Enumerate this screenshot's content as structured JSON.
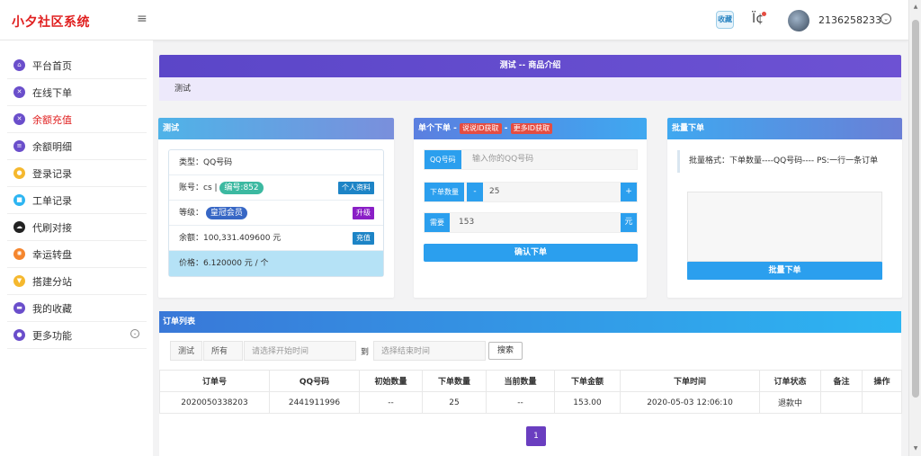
{
  "header": {
    "brand": "小夕社区系统",
    "menu_icon": "≡",
    "fav_label": "收藏",
    "username": "2136258233"
  },
  "sidebar": {
    "items": [
      {
        "label": "平台首页",
        "icon": "home-icon",
        "color": "#6a4ecb"
      },
      {
        "label": "在线下单",
        "icon": "cart-icon",
        "color": "#6a4ecb"
      },
      {
        "label": "余额充值",
        "icon": "wallet-icon",
        "color": "#6a4ecb"
      },
      {
        "label": "余额明细",
        "icon": "list-icon",
        "color": "#6a4ecb"
      },
      {
        "label": "登录记录",
        "icon": "login-icon",
        "color": "#f5b82e"
      },
      {
        "label": "工单记录",
        "icon": "ticket-icon",
        "color": "#2db5f2"
      },
      {
        "label": "代刷对接",
        "icon": "cloud-icon",
        "color": "#222222"
      },
      {
        "label": "幸运转盘",
        "icon": "wheel-icon",
        "color": "#f5862e"
      },
      {
        "label": "搭建分站",
        "icon": "build-icon",
        "color": "#f5b82e"
      },
      {
        "label": "我的收藏",
        "icon": "collect-icon",
        "color": "#6a4ecb"
      },
      {
        "label": "更多功能",
        "icon": "more-icon",
        "color": "#6a4ecb"
      }
    ],
    "active_index": 2
  },
  "intro": {
    "title": "测试 -- 商品介绍",
    "body": "测试"
  },
  "info_panel": {
    "title": "测试",
    "type_text": "类型：QQ号码",
    "account_text": "账号：cs |",
    "id_badge": "编号:852",
    "profile_btn": "个人资料",
    "level_text": "等级：",
    "level_badge": "皇冠会员",
    "upgrade_btn": "升级",
    "balance_text": "余额：100,331.409600 元",
    "recharge_btn": "充值",
    "price_text": "价格：6.120000 元 / 个"
  },
  "order_panel": {
    "title": "单个下单 -",
    "tag1": "说说ID获取",
    "sep": "-",
    "tag2": "更多ID获取",
    "qq_label": "QQ号码",
    "qq_placeholder": "输入你的QQ号码",
    "qty_label": "下单数量",
    "minus": "-",
    "qty_value": "25",
    "plus": "+",
    "need_label": "需要",
    "need_value": "153",
    "unit": "元",
    "confirm": "确认下单"
  },
  "batch_panel": {
    "title": "批量下单",
    "note": "批量格式：下单数量----QQ号码---- PS:一行一条订单",
    "button": "批量下单"
  },
  "orders": {
    "title": "订单列表",
    "filter_product": "测试",
    "filter_status": "所有",
    "start_placeholder": "请选择开始时间",
    "to": "到",
    "end_placeholder": "选择结束时间",
    "search_btn": "搜索",
    "columns": [
      "订单号",
      "QQ号码",
      "初始数量",
      "下单数量",
      "当前数量",
      "下单金额",
      "下单时间",
      "订单状态",
      "备注",
      "操作"
    ],
    "rows": [
      [
        "2020050338203",
        "2441911996",
        "--",
        "25",
        "--",
        "153.00",
        "2020-05-03 12:06:10",
        "退款中",
        "",
        ""
      ]
    ],
    "page": "1"
  }
}
